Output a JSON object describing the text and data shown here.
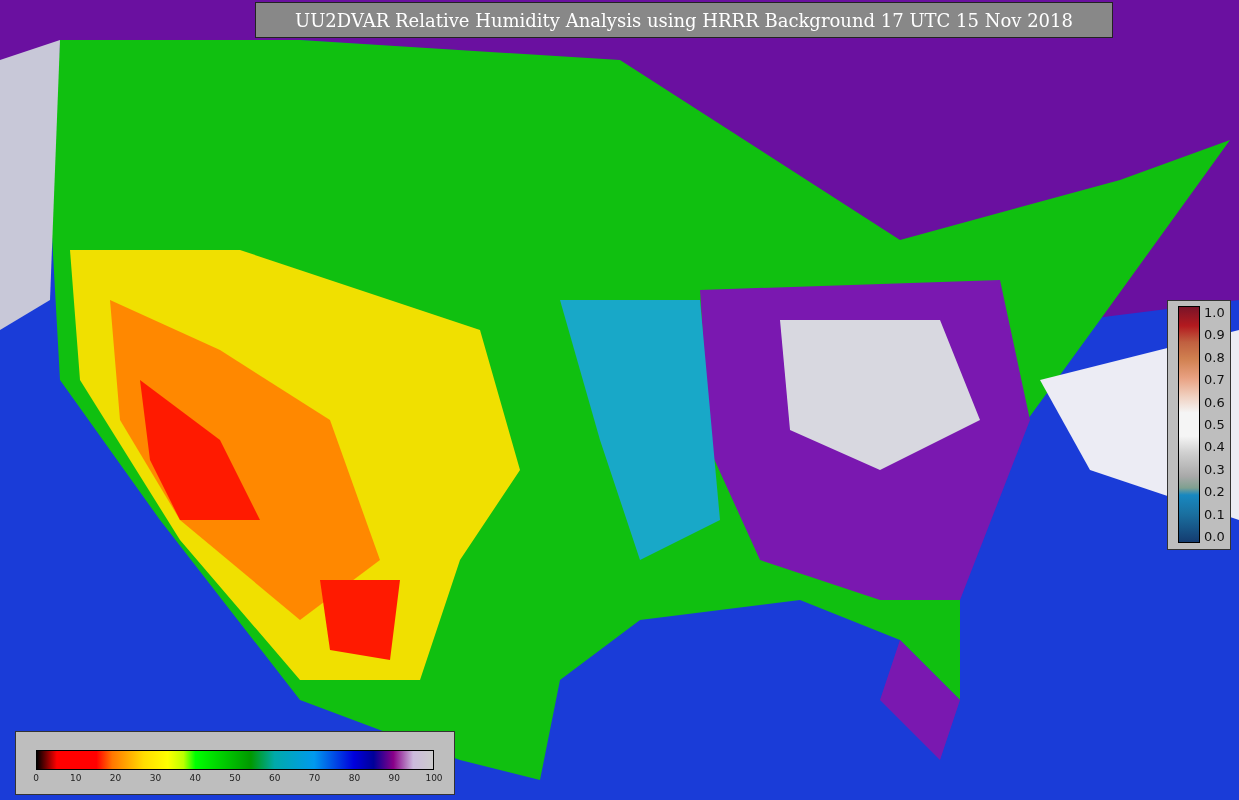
{
  "title": "UU2DVAR Relative Humidity Analysis using HRRR Background 17 UTC 15 Nov 2018",
  "humidity_colorbar": {
    "ticks": [
      "0",
      "10",
      "20",
      "30",
      "40",
      "50",
      "60",
      "70",
      "80",
      "90",
      "100"
    ]
  },
  "station_colorbar": {
    "ticks": [
      "1.0",
      "0.9",
      "0.8",
      "0.7",
      "0.6",
      "0.5",
      "0.4",
      "0.3",
      "0.2",
      "0.1",
      "0.0"
    ]
  }
}
